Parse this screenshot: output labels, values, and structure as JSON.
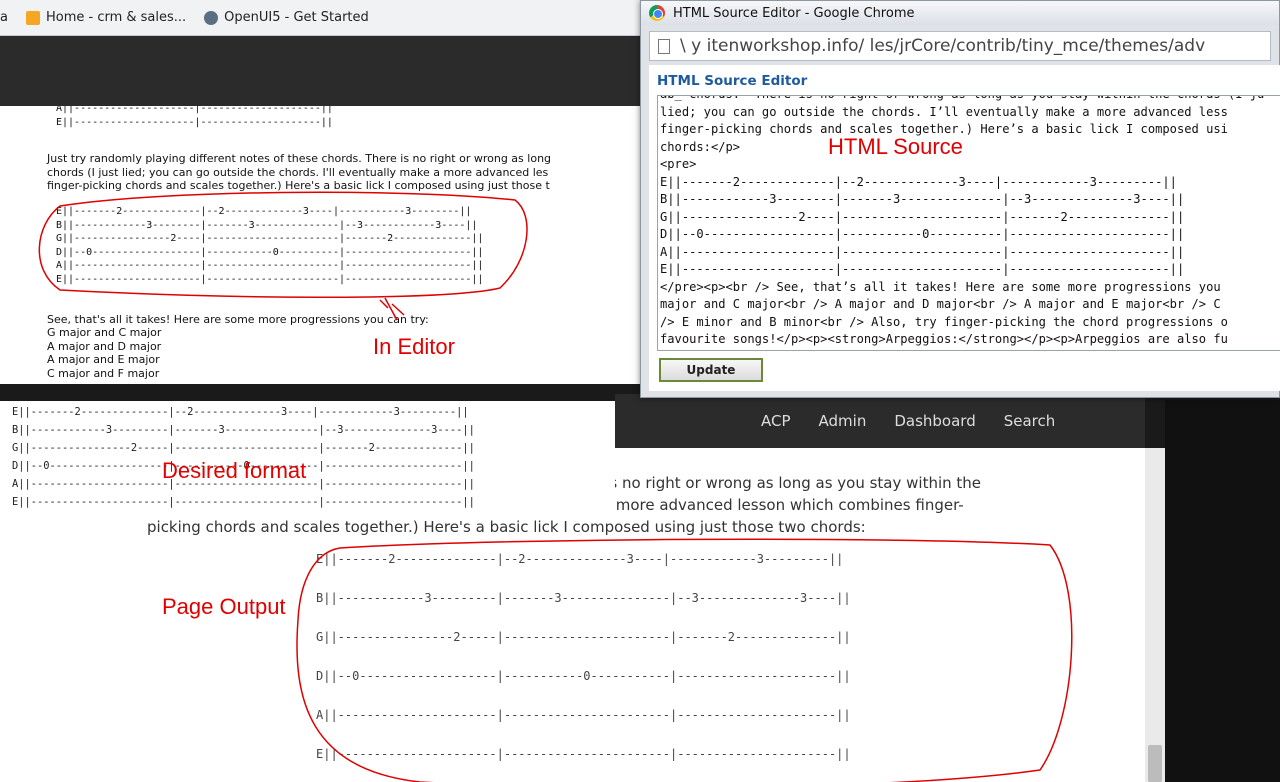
{
  "browser": {
    "bookmarks": [
      {
        "label": "a",
        "icon": "bookmark-icon"
      },
      {
        "label": "Home - crm & sales...",
        "icon": "home-folder-icon"
      },
      {
        "label": "OpenUI5 - Get Started",
        "icon": "openui5-icon"
      }
    ]
  },
  "editor": {
    "tab_top": "A||--------------------|--------------------||\nE||--------------------|--------------------||",
    "paragraph": "Just try randomly playing different notes of these chords. There is no right or wrong as long\nchords (I just lied; you can go outside the chords. I'll eventually make a more advanced les\nfinger-picking chords and scales together.) Here's a basic lick I composed using just those t",
    "tab": "E||-------2-------------|--2-------------3----|-----------3--------||\nB||------------3--------|-------3--------------|--3------------3----||\nG||----------------2----|----------------------|-------2-------------||\nD||--0------------------|-----------0----------|---------------------||\nA||---------------------|----------------------|---------------------||\nE||---------------------|----------------------|---------------------||",
    "progressions_intro": "See, that's all it takes! Here are some more progressions you can try:",
    "progressions": [
      "G major and C major",
      "A major and D major",
      "A major and E major",
      "C major and F major"
    ]
  },
  "popup": {
    "window_title": "HTML Source Editor - Google Chrome",
    "url": "\\          y           itenworkshop.info/        les/jrCore/contrib/tiny_mce/themes/adv",
    "heading": "HTML Source Editor",
    "source": "ab_ chords.  There is no right or wrong as long as you stay within the chords (I ju\nlied; you can go outside the chords. I’ll eventually make a more advanced less\nfinger-picking chords and scales together.) Here’s a basic lick I composed usi\nchords:</p>\n<pre>\nE||-------2-------------|--2-------------3----|------------3---------||\nB||------------3--------|-------3--------------|--3--------------3----||\nG||----------------2----|----------------------|-------2--------------||\nD||--0------------------|-----------0----------|----------------------||\nA||---------------------|----------------------|----------------------||\nE||---------------------|----------------------|----------------------||\n</pre><p><br /> See, that’s all it takes! Here are some more progressions you\nmajor and C major<br /> A major and D major<br /> A major and E major<br /> C\n/> E minor and B minor<br /> Also, try finger-picking the chord progressions o\nfavourite songs!</p><p><strong>Arpeggios:</strong></p><p>Arpeggios are also fu\nsongs. Have you ever heard of Yngvie Malmsteen? If you haven't, then you don't",
    "update_label": "Update"
  },
  "desired": {
    "tab": "E||-------2--------------|--2--------------3----|------------3---------||\nB||------------3---------|-------3---------------|--3--------------3----||\nG||----------------2-----|-----------------------|-------2--------------||\nD||--0-------------------|-----------0-----------|----------------------||\nA||----------------------|-----------------------|----------------------||\nE||----------------------|-----------------------|----------------------||"
  },
  "site": {
    "nav": [
      "ACP",
      "Admin",
      "Dashboard",
      "Search"
    ],
    "body_text": "                                                                                          ere is no right or wrong as long as you stay within the\n                                                                                  ly make a more advanced lesson which combines finger-\npicking chords and scales together.) Here's a basic lick I composed using just those two chords:",
    "tab": "E||-------2--------------|--2--------------3----|------------3---------||\nB||------------3---------|-------3---------------|--3--------------3----||\nG||----------------2-----|-----------------------|-------2--------------||\nD||--0-------------------|-----------0-----------|----------------------||\nA||----------------------|-----------------------|----------------------||\nE||----------------------|-----------------------|----------------------||"
  },
  "annotations": {
    "html_source": "HTML Source",
    "in_editor": "In Editor",
    "desired_format": "Desired format",
    "page_output": "Page Output"
  },
  "colors": {
    "annotation": "#e00000",
    "editor_heading": "#1e5a9e",
    "nav_bar": "#2b2b2b"
  }
}
